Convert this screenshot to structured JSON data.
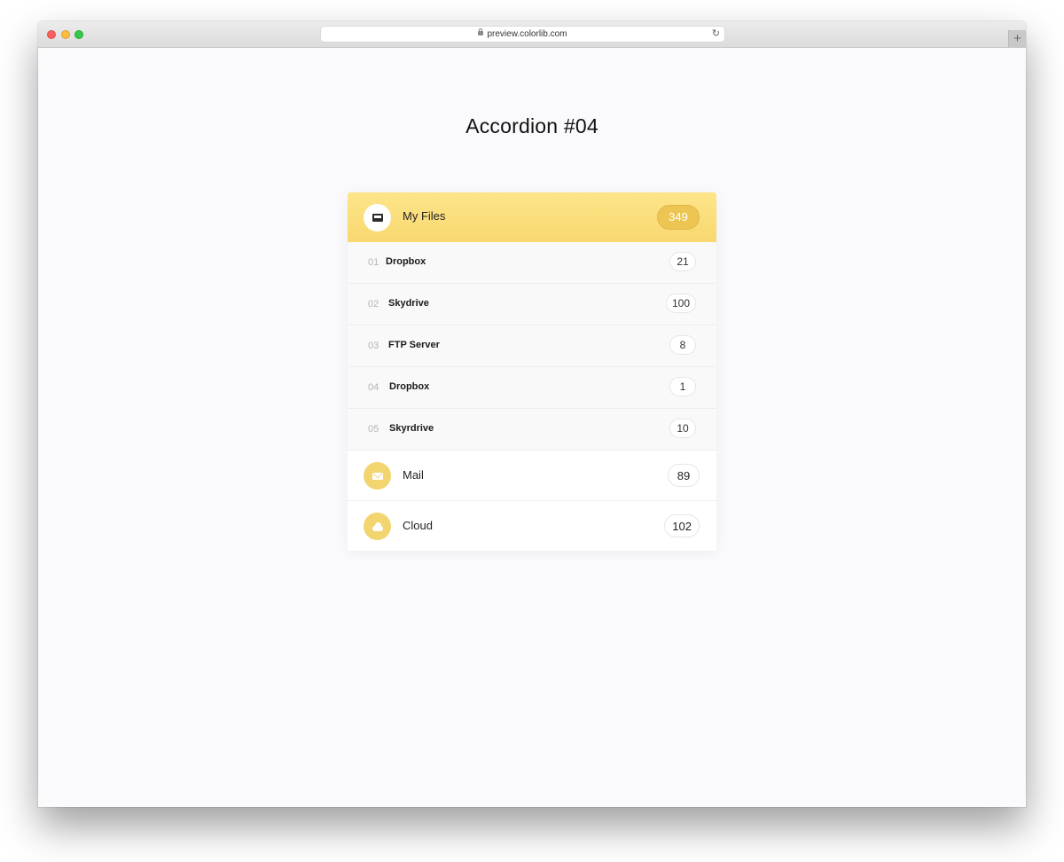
{
  "browser": {
    "url": "preview.colorlib.com",
    "new_tab": "+"
  },
  "page": {
    "title": "Accordion #04"
  },
  "accordion": {
    "active": {
      "icon": "folder-icon",
      "label": "My Files",
      "count": "349",
      "accent": "#fde58a",
      "items": [
        {
          "num": "01",
          "name": "Dropbox",
          "count": "21"
        },
        {
          "num": "02",
          "name": "Skydrive",
          "count": "100"
        },
        {
          "num": "03",
          "name": "FTP Server",
          "count": "8"
        },
        {
          "num": "04",
          "name": "Dropbox",
          "count": "1"
        },
        {
          "num": "05",
          "name": "Skyrdrive",
          "count": "10"
        }
      ]
    },
    "sections": [
      {
        "icon": "envelope-icon",
        "label": "Mail",
        "count": "89"
      },
      {
        "icon": "cloud-icon",
        "label": "Cloud",
        "count": "102"
      }
    ]
  }
}
